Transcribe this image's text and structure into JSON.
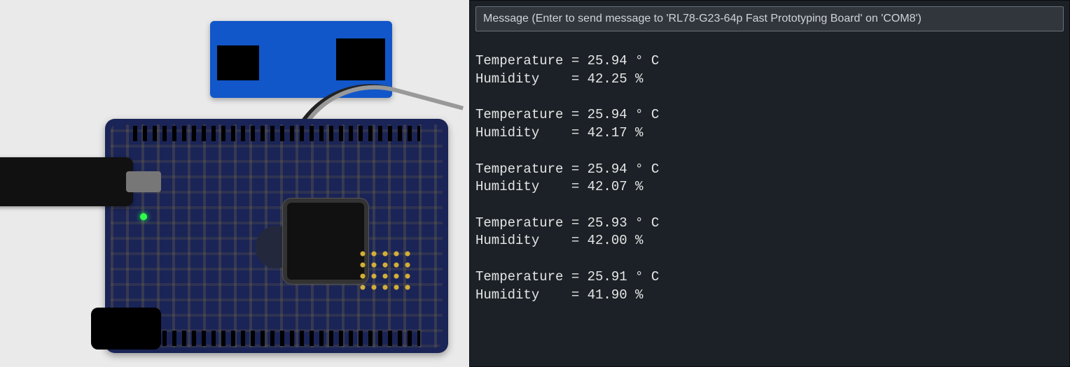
{
  "serial": {
    "message_placeholder": "Message (Enter to send message to 'RL78-G23-64p Fast Prototyping Board' on 'COM8')",
    "readings": [
      {
        "temperature": "25.94",
        "humidity": "42.25"
      },
      {
        "temperature": "25.94",
        "humidity": "42.17"
      },
      {
        "temperature": "25.94",
        "humidity": "42.07"
      },
      {
        "temperature": "25.93",
        "humidity": "42.00"
      },
      {
        "temperature": "25.91",
        "humidity": "41.90"
      }
    ],
    "labels": {
      "temperature": "Temperature",
      "humidity": "Humidity",
      "temp_unit": "° C",
      "hum_unit": "%"
    }
  }
}
